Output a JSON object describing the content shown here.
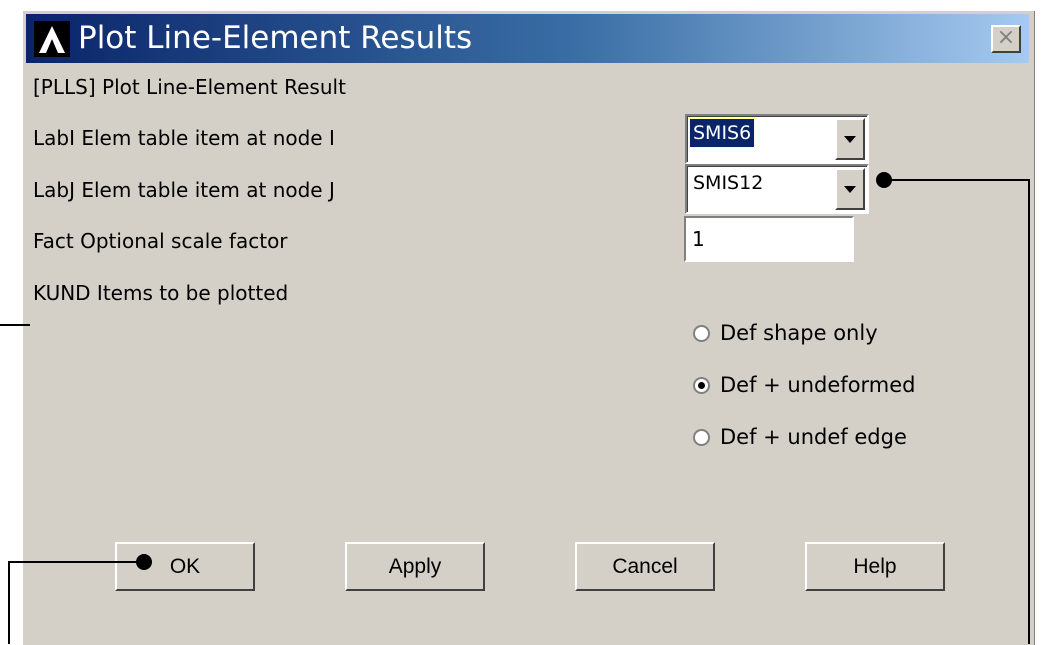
{
  "window": {
    "title": "Plot Line-Element Results",
    "close_label": "×"
  },
  "header_label": "[PLLS]  Plot Line-Element Result",
  "fields": {
    "labi": {
      "label": "LabI  Elem table item at node I",
      "value": "SMIS6"
    },
    "labj": {
      "label": "LabJ  Elem table item at node J",
      "value": "SMIS12"
    },
    "fact": {
      "label": "Fact  Optional scale factor",
      "value": "1"
    },
    "kund": {
      "label": "KUND   Items to be plotted"
    }
  },
  "kund_options": [
    {
      "label": "Def shape only",
      "selected": false
    },
    {
      "label": "Def + undeformed",
      "selected": true
    },
    {
      "label": "Def + undef edge",
      "selected": false
    }
  ],
  "buttons": {
    "ok": "OK",
    "apply": "Apply",
    "cancel": "Cancel",
    "help": "Help"
  },
  "colors": {
    "title_start": "#0a246a",
    "title_end": "#a6caf0",
    "dialog_bg": "#d4d0c8"
  }
}
